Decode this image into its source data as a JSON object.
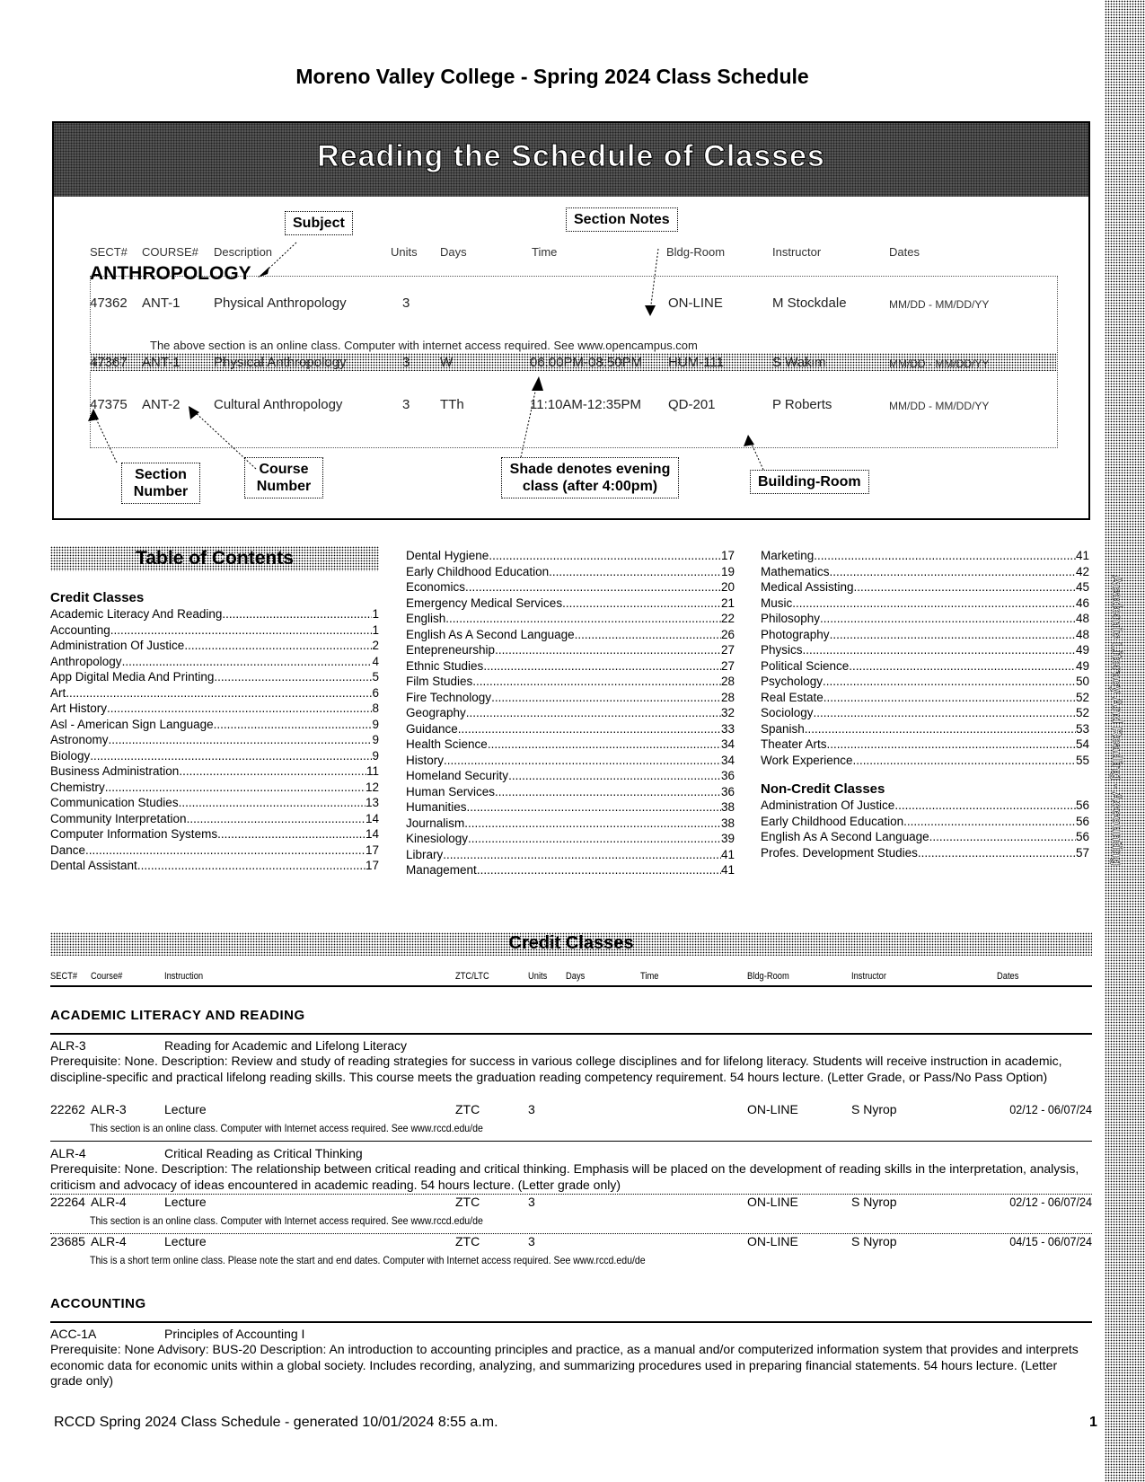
{
  "title": "Moreno Valley College - Spring 2024 Class Schedule",
  "legend": {
    "heading": "Reading the Schedule of Classes",
    "callouts": {
      "subject": "Subject",
      "section_notes": "Section Notes",
      "section_number": "Section Number",
      "course_number": "Course Number",
      "shade": "Shade denotes evening class (after 4:00pm)",
      "building_room": "Building-Room"
    },
    "columns": [
      "SECT#",
      "COURSE#",
      "Description",
      "Units",
      "Days",
      "Time",
      "Bldg-Room",
      "Instructor",
      "Dates"
    ],
    "subject": "ANTHROPOLOGY",
    "rows": [
      {
        "sect": "47362",
        "course": "ANT-1",
        "desc": "Physical Anthropology",
        "units": "3",
        "days": "",
        "time": "",
        "room": "ON-LINE",
        "instructor": "M Stockdale",
        "dates": "MM/DD - MM/DD/YY",
        "shaded": false
      },
      {
        "sect": "47367",
        "course": "ANT-1",
        "desc": "Physical Anthropology",
        "units": "3",
        "days": "W",
        "time": "06:00PM-08:50PM",
        "room": "HUM-111",
        "instructor": "S Wakim",
        "dates": "MM/DD - MM/DD/YY",
        "shaded": true
      },
      {
        "sect": "47375",
        "course": "ANT-2",
        "desc": "Cultural Anthropology",
        "units": "3",
        "days": "TTh",
        "time": "11:10AM-12:35PM",
        "room": "QD-201",
        "instructor": "P Roberts",
        "dates": "MM/DD - MM/DD/YY",
        "shaded": false
      }
    ],
    "note": "The above section is an online class. Computer with internet access required. See www.opencampus.com"
  },
  "toc": {
    "heading": "Table of Contents",
    "credit_heading": "Credit Classes",
    "noncredit_heading": "Non-Credit Classes",
    "col1": [
      [
        "Academic Literacy And Reading",
        "1"
      ],
      [
        "Accounting",
        "1"
      ],
      [
        "Administration Of Justice",
        "2"
      ],
      [
        "Anthropology",
        "4"
      ],
      [
        "App Digital Media And Printing",
        "5"
      ],
      [
        "Art",
        "6"
      ],
      [
        "Art History",
        "8"
      ],
      [
        "Asl - American Sign Language",
        "9"
      ],
      [
        "Astronomy",
        "9"
      ],
      [
        "Biology",
        "9"
      ],
      [
        "Business Administration",
        "11"
      ],
      [
        "Chemistry",
        "12"
      ],
      [
        "Communication Studies",
        "13"
      ],
      [
        "Community Interpretation",
        "14"
      ],
      [
        "Computer Information Systems",
        "14"
      ],
      [
        "Dance",
        "17"
      ],
      [
        "Dental Assistant",
        "17"
      ]
    ],
    "col2": [
      [
        "Dental Hygiene",
        "17"
      ],
      [
        "Early Childhood Education",
        "19"
      ],
      [
        "Economics",
        "20"
      ],
      [
        "Emergency Medical Services",
        "21"
      ],
      [
        "English",
        "22"
      ],
      [
        "English As A Second Language",
        "26"
      ],
      [
        "Entepreneurship",
        "27"
      ],
      [
        "Ethnic Studies",
        "27"
      ],
      [
        "Film Studies",
        "28"
      ],
      [
        "Fire Technology",
        "28"
      ],
      [
        "Geography",
        "32"
      ],
      [
        "Guidance",
        "33"
      ],
      [
        "Health Science",
        "34"
      ],
      [
        "History",
        "34"
      ],
      [
        "Homeland Security",
        "36"
      ],
      [
        "Human Services",
        "36"
      ],
      [
        "Humanities",
        "38"
      ],
      [
        "Journalism",
        "38"
      ],
      [
        "Kinesiology",
        "39"
      ],
      [
        "Library",
        "41"
      ],
      [
        "Management",
        "41"
      ]
    ],
    "col3": [
      [
        "Marketing",
        "41"
      ],
      [
        "Mathematics",
        "42"
      ],
      [
        "Medical Assisting",
        "45"
      ],
      [
        "Music",
        "46"
      ],
      [
        "Philosophy",
        "48"
      ],
      [
        "Photography",
        "48"
      ],
      [
        "Physics",
        "49"
      ],
      [
        "Political Science",
        "49"
      ],
      [
        "Psychology",
        "50"
      ],
      [
        "Real Estate",
        "52"
      ],
      [
        "Sociology",
        "52"
      ],
      [
        "Spanish",
        "53"
      ],
      [
        "Theater Arts",
        "54"
      ],
      [
        "Work Experience",
        "55"
      ]
    ],
    "noncredit": [
      [
        "Administration Of Justice",
        "56"
      ],
      [
        "Early Childhood Education",
        "56"
      ],
      [
        "English As A Second Language",
        "56"
      ],
      [
        "Profes. Development Studies",
        "57"
      ]
    ]
  },
  "credit": {
    "heading": "Credit Classes",
    "columns": [
      "SECT#",
      "Course#",
      "Instruction",
      "ZTC/LTC",
      "Units",
      "Days",
      "Time",
      "Bldg-Room",
      "Instructor",
      "Dates"
    ],
    "alr": {
      "subject": "ACADEMIC LITERACY AND READING",
      "c1": {
        "code": "ALR-3",
        "title": "Reading for Academic and Lifelong Literacy",
        "desc": "Prerequisite: None. Description: Review and study of reading strategies for success in various college disciplines and for lifelong literacy. Students will receive instruction in academic, discipline-specific and practical lifelong reading skills. This course meets the graduation reading competency requirement. 54 hours lecture. (Letter Grade, or Pass/No Pass Option)",
        "sections": [
          {
            "sect": "22262",
            "course": "ALR-3",
            "instr": "Lecture",
            "ztc": "ZTC",
            "units": "3",
            "room": "ON-LINE",
            "instructor": "S Nyrop",
            "dates": "02/12 - 06/07/24",
            "note": "This section is an online class. Computer with Internet access required. See www.rccd.edu/de"
          }
        ]
      },
      "c2": {
        "code": "ALR-4",
        "title": "Critical Reading as Critical Thinking",
        "desc": "Prerequisite: None. Description: The relationship between critical reading and critical thinking. Emphasis will be placed on the development of reading skills in the interpretation, analysis, criticism and advocacy of ideas encountered in academic reading. 54 hours lecture. (Letter grade only)",
        "sections": [
          {
            "sect": "22264",
            "course": "ALR-4",
            "instr": "Lecture",
            "ztc": "ZTC",
            "units": "3",
            "room": "ON-LINE",
            "instructor": "S Nyrop",
            "dates": "02/12 - 06/07/24",
            "note": "This section is an online class. Computer with Internet access required. See www.rccd.edu/de"
          },
          {
            "sect": "23685",
            "course": "ALR-4",
            "instr": "Lecture",
            "ztc": "ZTC",
            "units": "3",
            "room": "ON-LINE",
            "instructor": "S Nyrop",
            "dates": "04/15 - 06/07/24",
            "note": "This is a short term online class. Please note the start and end dates. Computer with Internet access required. See www.rccd.edu/de"
          }
        ]
      }
    },
    "acc": {
      "subject": "ACCOUNTING",
      "c1": {
        "code": "ACC-1A",
        "title": "Principles of Accounting I",
        "desc": "Prerequisite: None Advisory: BUS-20 Description: An introduction to accounting principles and practice, as a manual and/or computerized information system that provides and interprets economic data for economic units within a global society. Includes recording, analyzing, and summarizing procedures used in preparing financial statements. 54 hours lecture. (Letter grade only)"
      }
    }
  },
  "sidebar": "Academic Literacy And Reading - Accounting",
  "footer": "RCCD Spring 2024 Class Schedule - generated 10/01/2024 8:55 a.m.",
  "page_number": "1"
}
